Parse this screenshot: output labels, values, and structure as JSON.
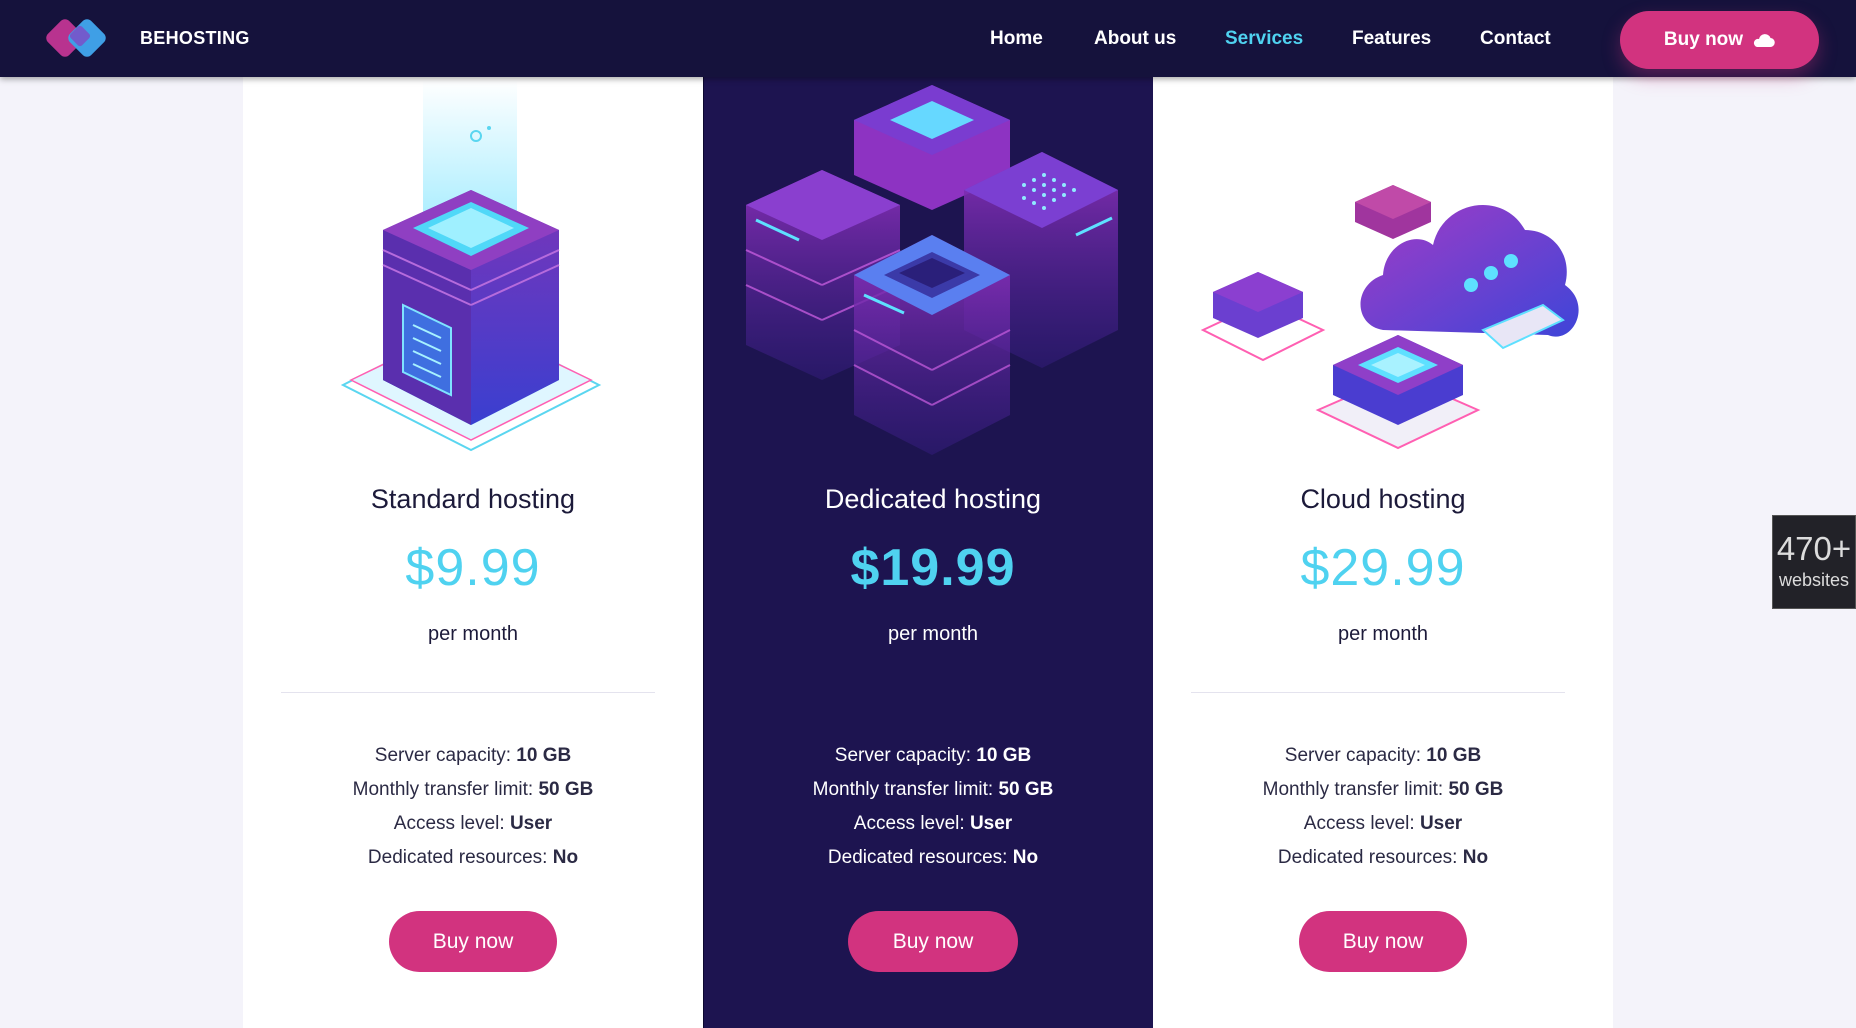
{
  "brand": {
    "name": "BEHOSTING"
  },
  "nav": {
    "items": [
      {
        "label": "Home",
        "active": false
      },
      {
        "label": "About us",
        "active": false
      },
      {
        "label": "Services",
        "active": true
      },
      {
        "label": "Features",
        "active": false
      },
      {
        "label": "Contact",
        "active": false
      }
    ],
    "buy_label": "Buy now",
    "buy_icon": "cloud-icon"
  },
  "colors": {
    "header_bg": "#15123c",
    "accent_cyan": "#4fd2f0",
    "accent_pink": "#d2337f",
    "dark_card_bg": "#1d1450",
    "page_bg": "#f4f3fa"
  },
  "plans": [
    {
      "title": "Standard hosting",
      "price": "$9.99",
      "period": "per month",
      "illustration": "single-server-illustration",
      "features": [
        {
          "label": "Server capacity:",
          "value": "10 GB"
        },
        {
          "label": "Monthly transfer limit:",
          "value": "50 GB"
        },
        {
          "label": "Access level:",
          "value": "User"
        },
        {
          "label": "Dedicated resources:",
          "value": "No"
        }
      ],
      "button": "Buy now"
    },
    {
      "title": "Dedicated hosting",
      "price": "$19.99",
      "period": "per month",
      "illustration": "server-cluster-illustration",
      "features": [
        {
          "label": "Server capacity:",
          "value": "10 GB"
        },
        {
          "label": "Monthly transfer limit:",
          "value": "50 GB"
        },
        {
          "label": "Access level:",
          "value": "User"
        },
        {
          "label": "Dedicated resources:",
          "value": "No"
        }
      ],
      "button": "Buy now"
    },
    {
      "title": "Cloud hosting",
      "price": "$29.99",
      "period": "per month",
      "illustration": "cloud-server-illustration",
      "features": [
        {
          "label": "Server capacity:",
          "value": "10 GB"
        },
        {
          "label": "Monthly transfer limit:",
          "value": "50 GB"
        },
        {
          "label": "Access level:",
          "value": "User"
        },
        {
          "label": "Dedicated resources:",
          "value": "No"
        }
      ],
      "button": "Buy now"
    }
  ],
  "side_widget": {
    "count": "470+",
    "label": "websites"
  }
}
